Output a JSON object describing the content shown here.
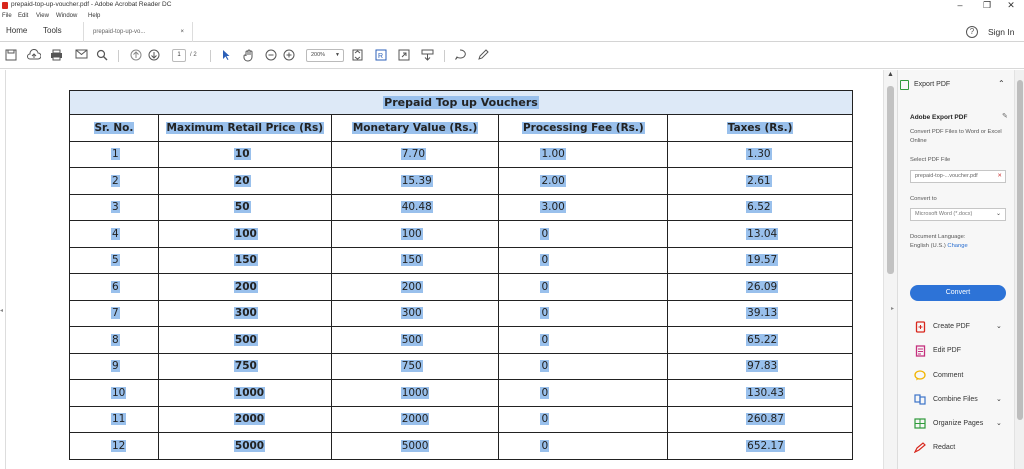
{
  "window": {
    "title": "prepaid-top-up-voucher.pdf - Adobe Acrobat Reader DC",
    "minimize": "–",
    "maximize": "❐",
    "close": "✕"
  },
  "menu": [
    "File",
    "Edit",
    "View",
    "Window",
    "Help"
  ],
  "tabs": {
    "home": "Home",
    "tools": "Tools",
    "document": "prepaid-top-up-vo...",
    "close": "×"
  },
  "header": {
    "help": "?",
    "signin": "Sign In"
  },
  "toolbar": {
    "page_current": "1",
    "page_total": "/ 2",
    "zoom": "200%"
  },
  "document": {
    "table_title": "Prepaid Top up Vouchers",
    "columns": [
      "Sr. No.",
      "Maximum Retail Price (Rs)",
      "Monetary Value (Rs.)",
      "Processing Fee (Rs.)",
      "Taxes (Rs.)"
    ],
    "rows": [
      [
        "1",
        "10",
        "7.70",
        "1.00",
        "1.30"
      ],
      [
        "2",
        "20",
        "15.39",
        "2.00",
        "2.61"
      ],
      [
        "3",
        "50",
        "40.48",
        "3.00",
        "6.52"
      ],
      [
        "4",
        "100",
        "100",
        "0",
        "13.04"
      ],
      [
        "5",
        "150",
        "150",
        "0",
        "19.57"
      ],
      [
        "6",
        "200",
        "200",
        "0",
        "26.09"
      ],
      [
        "7",
        "300",
        "300",
        "0",
        "39.13"
      ],
      [
        "8",
        "500",
        "500",
        "0",
        "65.22"
      ],
      [
        "9",
        "750",
        "750",
        "0",
        "97.83"
      ],
      [
        "10",
        "1000",
        "1000",
        "0",
        "130.43"
      ],
      [
        "11",
        "2000",
        "2000",
        "0",
        "260.87"
      ],
      [
        "12",
        "5000",
        "5000",
        "0",
        "652.17"
      ]
    ]
  },
  "right_pane": {
    "export_header": "Export PDF",
    "panel_title": "Adobe Export PDF",
    "description": "Convert PDF Files to Word or Excel Online",
    "select_file_label": "Select PDF File",
    "file_name": "prepaid-top-...voucher.pdf",
    "file_clear": "✕",
    "convert_to_label": "Convert to",
    "convert_to_value": "Microsoft Word (*.docx)",
    "doc_language_label": "Document Language:",
    "doc_language_value": "English (U.S.)",
    "change_link": "Change",
    "convert_button": "Convert",
    "tools": [
      {
        "label": "Create PDF",
        "icon": "create-pdf-icon",
        "color": "#d8261c"
      },
      {
        "label": "Edit PDF",
        "icon": "edit-pdf-icon",
        "color": "#c5307e"
      },
      {
        "label": "Comment",
        "icon": "comment-icon",
        "color": "#f1b400"
      },
      {
        "label": "Combine Files",
        "icon": "combine-files-icon",
        "color": "#3b73c9"
      },
      {
        "label": "Organize Pages",
        "icon": "organize-pages-icon",
        "color": "#2e9a3a"
      },
      {
        "label": "Redact",
        "icon": "redact-icon",
        "color": "#d8261c"
      }
    ]
  },
  "colors": {
    "selection_highlight": "#99c0ec",
    "title_row_fill": "#dde9f7",
    "convert_button": "#2d73d7"
  }
}
